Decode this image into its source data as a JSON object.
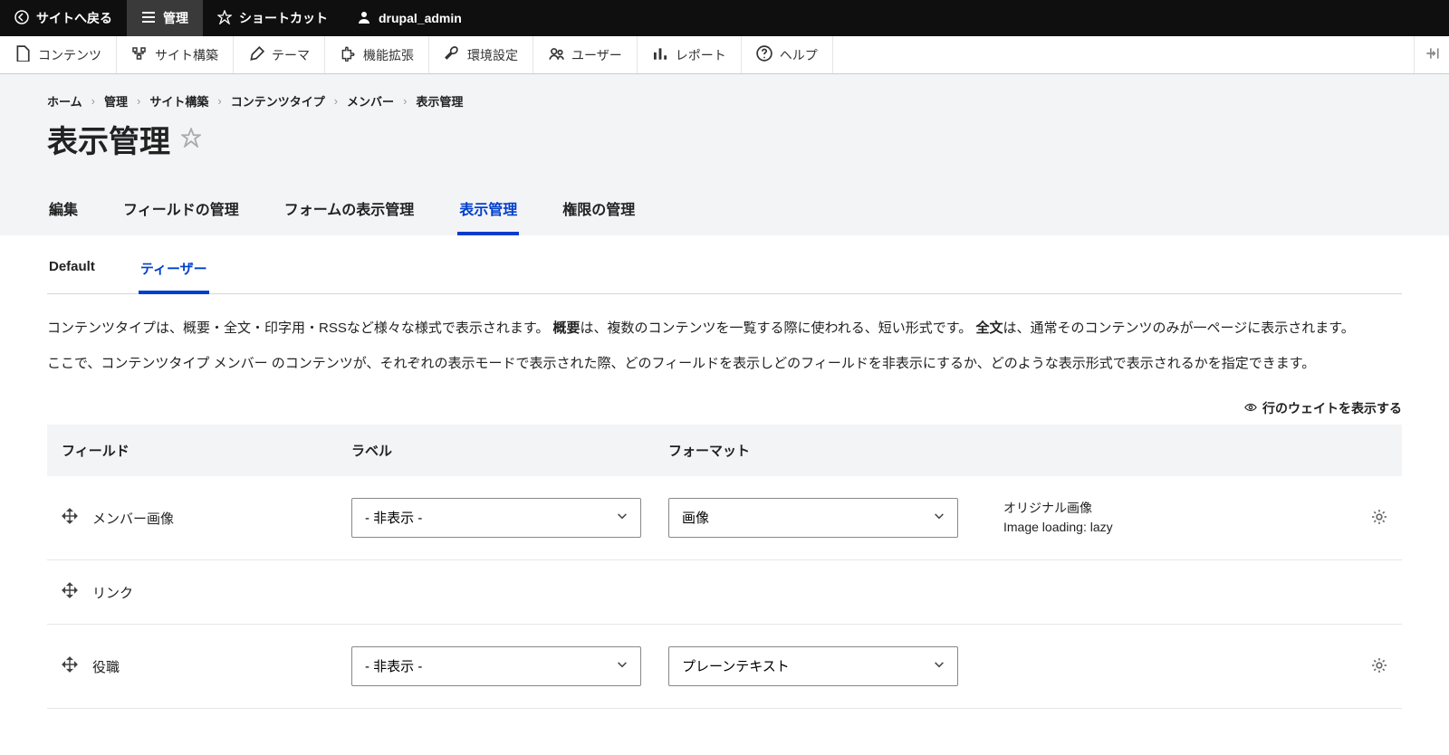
{
  "topbar": {
    "back": "サイトへ戻る",
    "manage": "管理",
    "shortcuts": "ショートカット",
    "user": "drupal_admin"
  },
  "toolbar": {
    "content": "コンテンツ",
    "structure": "サイト構築",
    "appearance": "テーマ",
    "extend": "機能拡張",
    "config": "環境設定",
    "people": "ユーザー",
    "reports": "レポート",
    "help": "ヘルプ"
  },
  "breadcrumb": [
    "ホーム",
    "管理",
    "サイト構築",
    "コンテンツタイプ",
    "メンバー",
    "表示管理"
  ],
  "page_title": "表示管理",
  "primary_tabs": [
    {
      "label": "編集",
      "active": false
    },
    {
      "label": "フィールドの管理",
      "active": false
    },
    {
      "label": "フォームの表示管理",
      "active": false
    },
    {
      "label": "表示管理",
      "active": true
    },
    {
      "label": "権限の管理",
      "active": false
    }
  ],
  "sub_tabs": [
    {
      "label": "Default",
      "active": false
    },
    {
      "label": "ティーザー",
      "active": true
    }
  ],
  "desc_parts": {
    "p1a": "コンテンツタイプは、概要・全文・印字用・RSSなど様々な様式で表示されます。",
    "p1b": "概要",
    "p1c": "は、複数のコンテンツを一覧する際に使われる、短い形式です。",
    "p1d": "全文",
    "p1e": "は、通常そのコンテンツのみが一ページに表示されます。",
    "p2": "ここで、コンテンツタイプ メンバー のコンテンツが、それぞれの表示モードで表示された際、どのフィールドを表示しどのフィールドを非表示にするか、どのような表示形式で表示されるかを指定できます。"
  },
  "weights_toggle": "行のウェイトを表示する",
  "columns": {
    "field": "フィールド",
    "label": "ラベル",
    "format": "フォーマット"
  },
  "rows": [
    {
      "name": "メンバー画像",
      "label": "- 非表示 -",
      "format": "画像",
      "summary1": "オリジナル画像",
      "summary2": "Image loading: lazy",
      "has_selects": true,
      "has_gear": true
    },
    {
      "name": "リンク",
      "label": "",
      "format": "",
      "summary1": "",
      "summary2": "",
      "has_selects": false,
      "has_gear": false
    },
    {
      "name": "役職",
      "label": "- 非表示 -",
      "format": "プレーンテキスト",
      "summary1": "",
      "summary2": "",
      "has_selects": true,
      "has_gear": true
    }
  ]
}
